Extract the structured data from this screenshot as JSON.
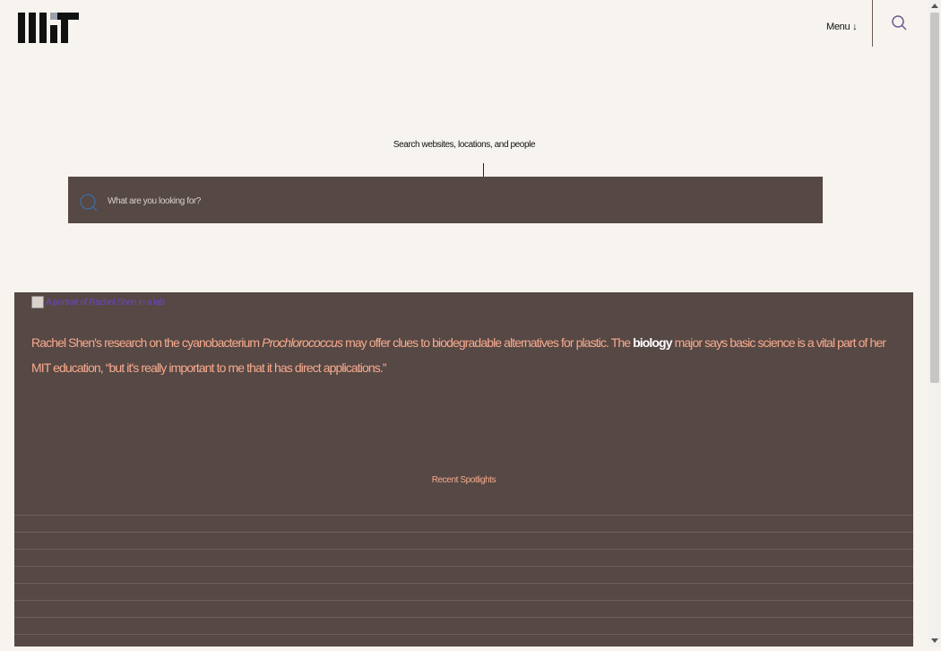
{
  "header": {
    "logo_alt": "MIT",
    "menu_label": "Menu ↓",
    "search_toggle_icon": "search-icon"
  },
  "search": {
    "label": "Search websites, locations, and people",
    "placeholder": "What are you looking for?",
    "value": ""
  },
  "spotlight": {
    "image_alt": "A portrait of Rachel Shen in a lab",
    "caption_parts": {
      "a": "Rachel Shen's research on the cyanobacterium ",
      "b": "Prochlorococcus",
      "c": " may offer clues to biodegradable alternatives for plastic. The ",
      "link": "biology",
      "d": " major says basic science is a vital part of her MIT education, “but it's really important to me that it has direct applications.”"
    },
    "recent_label": "Recent Spotlights"
  },
  "colors": {
    "background": "#f7f4ef",
    "panel": "#564844",
    "accent": "#f7aa8e"
  }
}
